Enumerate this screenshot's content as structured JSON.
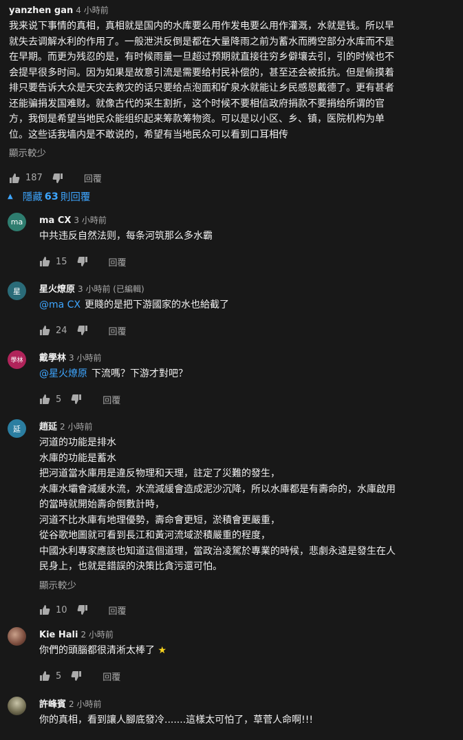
{
  "top_comment": {
    "author": "yanzhen gan",
    "time": "4 小時前",
    "lines": [
      "我来说下事情的真相，真相就是国内的水库要么用作发电要么用作灌溉，水就是钱。所以早",
      "就失去调解水利的作用了。一般泄洪反倒是都在大量降雨之前为蓄水而腾空部分水库而不是",
      "在早期。而更为残忍的是，有时候雨量一旦超过预期就直接往穷乡僻壤去引，引的时候也不",
      "会提早很多时间。因为如果是故意引流是需要给村民补偿的，甚至还会被抵抗。但是偷摸着",
      "排只要告诉大众是天灾去救灾的话只要给点泡面和矿泉水就能让乡民感恩戴德了。更有甚者",
      "还能骗捐发国难财。就像古代的采生割折，这个时候不要相信政府捐款不要捐给所谓的官",
      "方，我倒是希望当地民众能组织起来筹款筹物资。可以是以小区、乡、镇，医院机构为单",
      "位。这些话我墙内是不敢说的，希望有当地民众可以看到口耳相传"
    ],
    "show_less": "顯示較少",
    "likes": "187",
    "reply_label": "回覆"
  },
  "replies_toggle": {
    "prefix": "隱藏",
    "count": "63",
    "suffix": "則回覆"
  },
  "replies": [
    {
      "author": "ma CX",
      "avatar_text": "ma",
      "avatar_color": "#2e7d6f",
      "time": "3 小時前",
      "mention": "",
      "lines": [
        "中共违反自然法则，每条河筑那么多水霸"
      ],
      "likes": "15",
      "reply_label": "回覆"
    },
    {
      "author": "星火燎原",
      "avatar_text": "星",
      "avatar_color": "#2a6b78",
      "time": "3 小時前 (已編輯)",
      "mention": "@ma CX",
      "lines": [
        "更賤的是把下游國家的水也給截了"
      ],
      "likes": "24",
      "reply_label": "回覆"
    },
    {
      "author": "戴學林",
      "avatar_text": "學林",
      "avatar_color": "#b0245a",
      "time": "3 小時前",
      "mention": "@星火燎原",
      "lines": [
        "下流嗎？下游才對吧？"
      ],
      "likes": "5",
      "reply_label": "回覆"
    },
    {
      "author": "趙延",
      "avatar_text": "延",
      "avatar_color": "#2b7ea1",
      "time": "2 小時前",
      "mention": "",
      "lines": [
        "河道的功能是排水",
        "水庫的功能是蓄水",
        "把河道當水庫用是違反物理和天理，註定了災難的發生，",
        "水庫水壩會減緩水流，水流減緩會造成泥沙沉降，所以水庫都是有壽命的，水庫啟用",
        "的當時就開始壽命倒數計時，",
        "河道不比水庫有地理優勢，壽命會更短，淤積會更嚴重，",
        "從谷歌地圖就可看到長江和黃河流域淤積嚴重的程度，",
        "中國水利專家應該也知道這個道理，當政治凌駕於專業的時候，悲劇永遠是發生在人",
        "民身上，也就是錯誤的決策比貪污還可怕。"
      ],
      "show_less": "顯示較少",
      "likes": "10",
      "reply_label": "回覆"
    },
    {
      "author": "Kie Hali",
      "avatar_text": "",
      "avatar_color": "#7a4b3c",
      "time": "2 小時前",
      "mention": "",
      "lines": [
        "你們的頭腦都很清淅太棒了"
      ],
      "likes": "5",
      "reply_label": "回覆"
    },
    {
      "author": "許峰賓",
      "avatar_text": "",
      "avatar_color": "#6f6a4f",
      "time": "2 小時前",
      "mention": "",
      "lines": [
        "你的真相，看到讓人腳底發冷.......這樣太可怕了，草菅人命啊!!!"
      ]
    }
  ]
}
